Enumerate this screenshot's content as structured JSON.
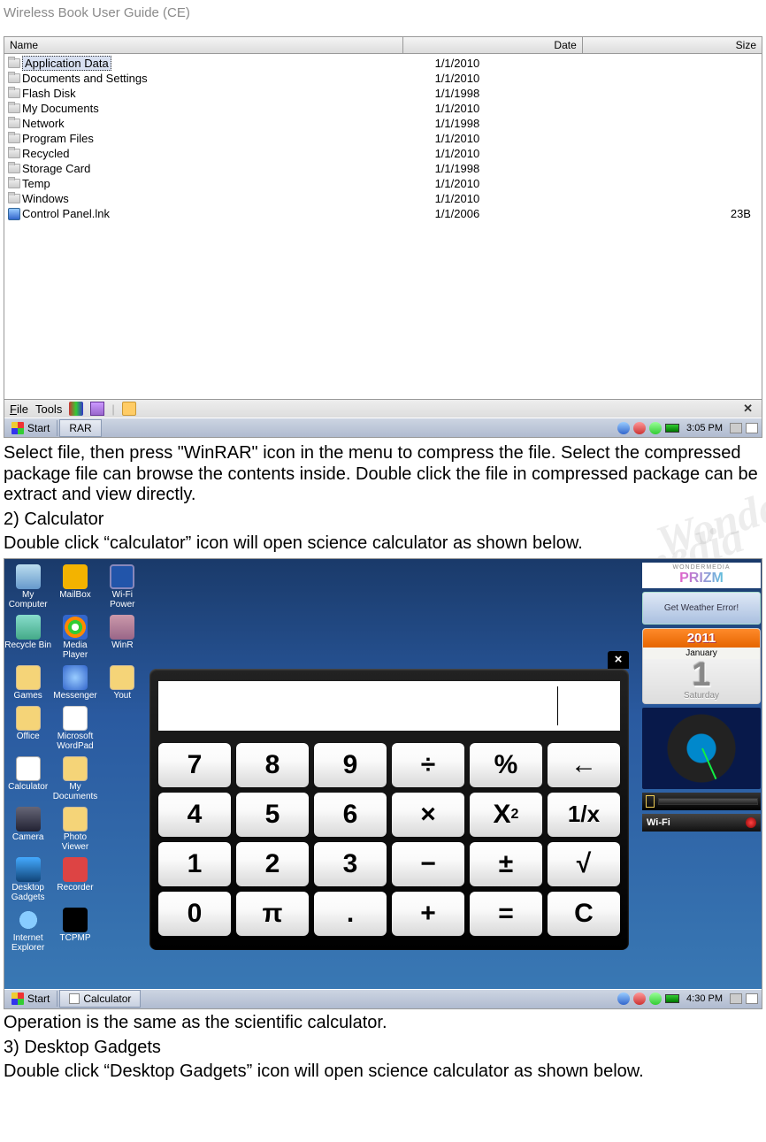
{
  "header": {
    "title": "Wireless Book User Guide (CE)"
  },
  "explorer": {
    "columns": {
      "name": "Name",
      "date": "Date",
      "size": "Size"
    },
    "rows": [
      {
        "name": "Application Data",
        "date": "1/1/2010",
        "size": "",
        "type": "folder",
        "selected": true
      },
      {
        "name": "Documents and Settings",
        "date": "1/1/2010",
        "size": "",
        "type": "folder"
      },
      {
        "name": "Flash Disk",
        "date": "1/1/1998",
        "size": "",
        "type": "folder"
      },
      {
        "name": "My Documents",
        "date": "1/1/2010",
        "size": "",
        "type": "folder"
      },
      {
        "name": "Network",
        "date": "1/1/1998",
        "size": "",
        "type": "folder"
      },
      {
        "name": "Program Files",
        "date": "1/1/2010",
        "size": "",
        "type": "folder"
      },
      {
        "name": "Recycled",
        "date": "1/1/2010",
        "size": "",
        "type": "folder"
      },
      {
        "name": "Storage Card",
        "date": "1/1/1998",
        "size": "",
        "type": "folder"
      },
      {
        "name": "Temp",
        "date": "1/1/2010",
        "size": "",
        "type": "folder"
      },
      {
        "name": "Windows",
        "date": "1/1/2010",
        "size": "",
        "type": "folder"
      },
      {
        "name": "Control Panel.lnk",
        "date": "1/1/2006",
        "size": "23B",
        "type": "link"
      }
    ],
    "toolbar": {
      "file": "File",
      "tools": "Tools"
    },
    "taskbar": {
      "start": "Start",
      "task": "RAR",
      "time": "3:05 PM"
    }
  },
  "para1": "Select file, then press \"WinRAR\" icon in the menu to compress the file. Select the compressed package file can browse the contents inside. Double click the file in compressed package can be extract and view directly.",
  "heading2": "2) Calculator",
  "para2": "Double click “calculator” icon will open science calculator as shown below.",
  "desktop": {
    "icons": [
      {
        "label": "My Computer",
        "cls": "ico-computer"
      },
      {
        "label": "MailBox",
        "cls": "ico-mail"
      },
      {
        "label": "Wi-Fi Power",
        "cls": "ico-wifi"
      },
      {
        "label": "Recycle Bin",
        "cls": "ico-recycle"
      },
      {
        "label": "Media Player",
        "cls": "ico-media"
      },
      {
        "label": "WinR",
        "cls": "ico-rar"
      },
      {
        "label": "Games",
        "cls": "ico-folder"
      },
      {
        "label": "Messenger",
        "cls": "ico-msn"
      },
      {
        "label": "Yout",
        "cls": "ico-folder"
      },
      {
        "label": "Office",
        "cls": "ico-folder"
      },
      {
        "label": "Microsoft WordPad",
        "cls": "ico-word"
      },
      {
        "label": "",
        "cls": ""
      },
      {
        "label": "Calculator",
        "cls": "ico-calc"
      },
      {
        "label": "My Documents",
        "cls": "ico-folder"
      },
      {
        "label": "",
        "cls": ""
      },
      {
        "label": "Camera",
        "cls": "ico-cam"
      },
      {
        "label": "Photo Viewer",
        "cls": "ico-folder"
      },
      {
        "label": "",
        "cls": ""
      },
      {
        "label": "Desktop Gadgets",
        "cls": "ico-gadgets"
      },
      {
        "label": "Recorder",
        "cls": "ico-rec"
      },
      {
        "label": "",
        "cls": ""
      },
      {
        "label": "Internet Explorer",
        "cls": "ico-ie"
      },
      {
        "label": "TCPMP",
        "cls": "ico-core"
      }
    ],
    "calculator": {
      "close": "×",
      "buttons_row1": [
        "7",
        "8",
        "9",
        "÷",
        "%",
        "←"
      ],
      "buttons_row2": [
        "4",
        "5",
        "6",
        "×",
        "X²",
        "1/x"
      ],
      "buttons_row3": [
        "1",
        "2",
        "3",
        "−",
        "±",
        "√"
      ],
      "buttons_row4": [
        "0",
        "π",
        ".",
        "+",
        "=",
        "C"
      ]
    },
    "gadgets": {
      "prizm": {
        "top": "WONDERMEDIA",
        "name": "PRIZM"
      },
      "weather": "Get Weather Error!",
      "cal": {
        "year": "2011",
        "month": "January",
        "day": "1",
        "dow": "Saturday"
      },
      "wifi": "Wi-Fi"
    },
    "taskbar": {
      "start": "Start",
      "task": "Calculator",
      "time": "4:30 PM"
    }
  },
  "para3": "Operation is the same as the scientific calculator.",
  "heading3": "3) Desktop Gadgets",
  "para4": "Double click “Desktop Gadgets” icon will open science calculator as shown below."
}
